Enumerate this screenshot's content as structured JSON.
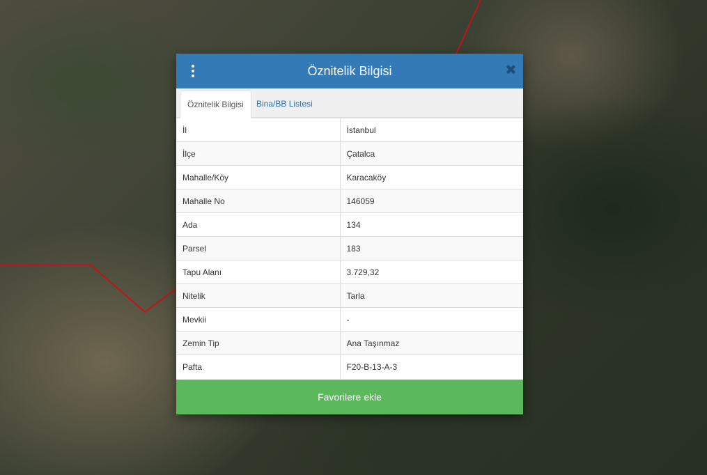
{
  "modal": {
    "title": "Öznitelik Bilgisi",
    "menu_icon": "kebab-menu-icon",
    "close_icon": "close-icon",
    "close_symbol": "✖",
    "header_color": "#337ab7",
    "tabs": [
      {
        "label": "Öznitelik Bilgisi",
        "active": true
      },
      {
        "label": "Bina/BB Listesi",
        "active": false
      }
    ],
    "rows": [
      {
        "key": "İl",
        "value": "İstanbul"
      },
      {
        "key": "İlçe",
        "value": "Çatalca"
      },
      {
        "key": "Mahalle/Köy",
        "value": "Karacaköy"
      },
      {
        "key": "Mahalle No",
        "value": "146059"
      },
      {
        "key": "Ada",
        "value": "134"
      },
      {
        "key": "Parsel",
        "value": "183"
      },
      {
        "key": "Tapu Alanı",
        "value": "3.729,32"
      },
      {
        "key": "Nitelik",
        "value": "Tarla"
      },
      {
        "key": "Mevkii",
        "value": "-"
      },
      {
        "key": "Zemin Tip",
        "value": "Ana Taşınmaz"
      },
      {
        "key": "Pafta",
        "value": "F20-B-13-A-3"
      }
    ],
    "favorite_button": "Favorilere ekle",
    "favorite_color": "#5cb85c"
  },
  "map": {
    "boundary_color": "#c0141c"
  }
}
